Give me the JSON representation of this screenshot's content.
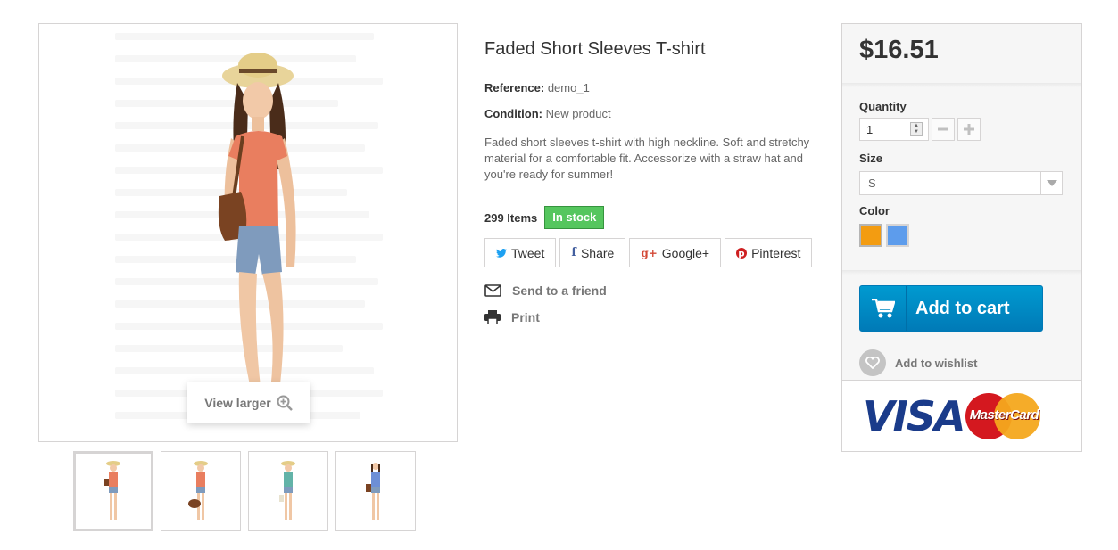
{
  "product": {
    "title": "Faded Short Sleeves T-shirt",
    "reference_label": "Reference:",
    "reference_value": "demo_1",
    "condition_label": "Condition:",
    "condition_value": "New product",
    "description": "Faded short sleeves t-shirt with high neckline. Soft and stretchy material for a comfortable fit. Accessorize with a straw hat and you're ready for summer!",
    "items_count": "299 Items",
    "stock_status": "In stock"
  },
  "gallery": {
    "view_larger": "View larger",
    "thumbnails": 4,
    "active_thumbnail": 1
  },
  "social": {
    "tweet": "Tweet",
    "share": "Share",
    "google": "Google+",
    "pinterest": "Pinterest"
  },
  "actions": {
    "send_to_friend": "Send to a friend",
    "print": "Print"
  },
  "buybox": {
    "price": "$16.51",
    "quantity_label": "Quantity",
    "quantity_value": "1",
    "size_label": "Size",
    "size_value": "S",
    "color_label": "Color",
    "colors": [
      "#f39c11",
      "#5d9cec"
    ],
    "add_to_cart": "Add to cart",
    "add_to_wishlist": "Add to wishlist",
    "card_visa": "VISA",
    "card_mastercard": "MasterCard"
  },
  "colors": {
    "accent_blue": "#009ad0",
    "in_stock_green": "#55c65e"
  }
}
